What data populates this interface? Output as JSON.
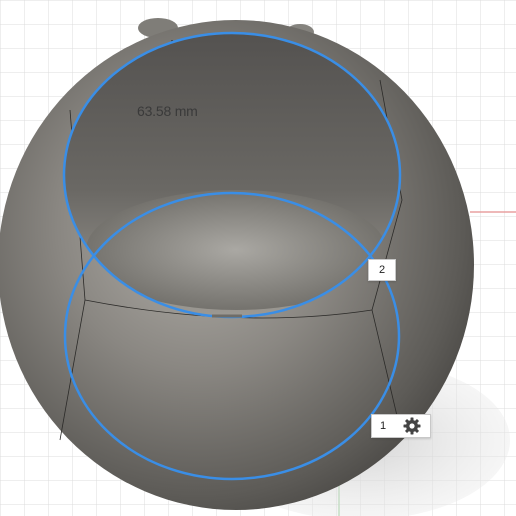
{
  "viewport": {
    "dimension_label": "63.58 mm",
    "handles": [
      {
        "label": "2"
      },
      {
        "label": "1",
        "icon": "gear-icon"
      }
    ],
    "colors": {
      "model": "#6e6c67",
      "selection_outline": "#3a8ee6",
      "grid": "#dcdcdc",
      "axis_red": "#e8a0a0",
      "axis_green": "#a9d8a9"
    }
  }
}
